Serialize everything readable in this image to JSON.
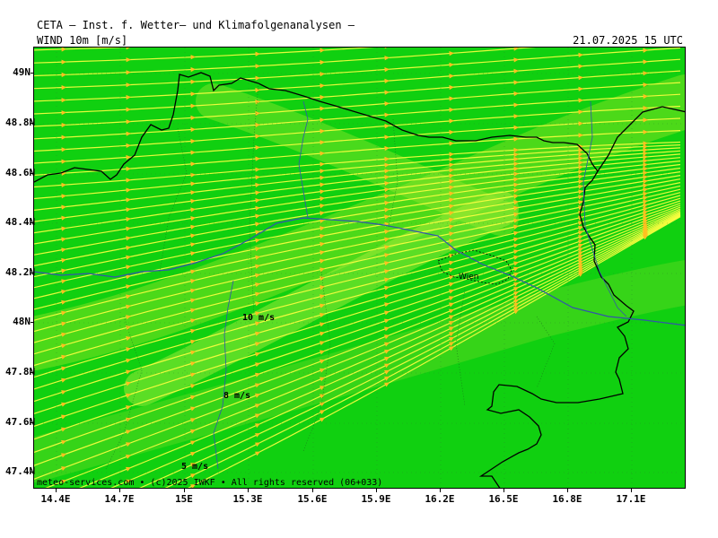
{
  "header": {
    "title": "CETA – Inst. f. Wetter– und Klimafolgenanalysen –",
    "variable": "WIND 10m [m/s]",
    "valid_time": "21.07.2025 15 UTC"
  },
  "footer": {
    "copyright": "meteo-services.com • (c)2025 IWKF • All rights reserved (06+033)"
  },
  "axes": {
    "x_ticks": [
      "14.4E",
      "14.7E",
      "15E",
      "15.3E",
      "15.6E",
      "15.9E",
      "16.2E",
      "16.5E",
      "16.8E",
      "17.1E"
    ],
    "y_ticks": [
      "49N",
      "48.8N",
      "48.6N",
      "48.4N",
      "48.2N",
      "48N",
      "47.8N",
      "47.6N",
      "47.4N"
    ]
  },
  "isotach_labels": [
    "10 m/s",
    "8 m/s",
    "5 m/s"
  ],
  "city": "Wien",
  "colors": {
    "background_fill": "#10d010",
    "streamline": "#ffff40",
    "border": "#000000",
    "river": "#3355aa"
  }
}
